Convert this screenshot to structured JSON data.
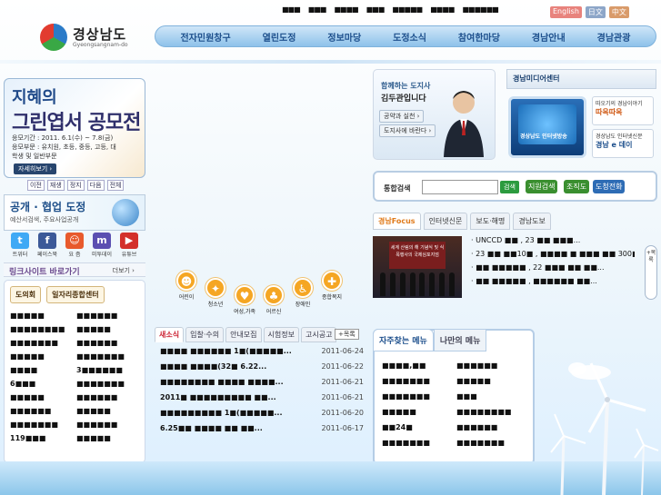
{
  "header": {
    "logo": {
      "title": "경상남도",
      "subtitle": "Gyeongsangnam-do"
    },
    "utility_links": [
      "■■■",
      "■■■",
      "■■■■",
      "■■■",
      "■■■■■",
      "■■■■",
      "■■■■■■"
    ],
    "languages": [
      {
        "label": "English",
        "color": "#e8837d"
      },
      {
        "label": "日文",
        "color": "#8da6c8"
      },
      {
        "label": "中文",
        "color": "#d99b6a"
      }
    ],
    "gnb": [
      "전자민원창구",
      "열린도정",
      "정보마당",
      "도정소식",
      "참여한마당",
      "경남안내",
      "경남관광"
    ]
  },
  "banner": {
    "line1": "지혜의",
    "line2": "그린엽서 공모전",
    "period": "응모기간 : 2011. 6.1(수) ~ 7.8(금)",
    "category": "응모부문 : 유치원, 초등, 중등, 고등, 대학생 및 일반부문",
    "more": "자세히보기 ›",
    "nav": [
      "이전",
      "재생",
      "정지",
      "다음",
      "전체"
    ]
  },
  "open_banner": {
    "title": "공개 · 협업 도정",
    "sub": "예산서검색, 주요사업공개"
  },
  "sns": [
    {
      "label": "트위터",
      "glyph": "t",
      "color": "#3fa9f5"
    },
    {
      "label": "페이스북",
      "glyph": "f",
      "color": "#3b5998"
    },
    {
      "label": "요 즘",
      "glyph": "☺",
      "color": "#e85a2c"
    },
    {
      "label": "미투데이",
      "glyph": "m",
      "color": "#5b4fb1"
    },
    {
      "label": "유튜브",
      "glyph": "▶",
      "color": "#d3302a"
    }
  ],
  "link_site": {
    "title": "링크사이트 바로가기",
    "more": "더보기 ›"
  },
  "left_list": {
    "tabs": [
      "도의회",
      "일자리종합센터"
    ],
    "items": [
      "■■■■■",
      "■■■■■■",
      "■■■■■■■■",
      "■■■■■",
      "■■■■■■■",
      "■■■■■■",
      "■■■■■",
      "■■■■■■■",
      "■■■■",
      "3■■■■■■",
      "6■■■",
      "■■■■■■■",
      "■■■■■",
      "■■■■■■",
      "■■■■■■",
      "■■■■■",
      "■■■■■■■",
      "■■■■■■",
      "119■■■",
      "■■■■■"
    ]
  },
  "icon_menu": [
    {
      "label": "어린이",
      "glyph": "☻"
    },
    {
      "label": "청소년",
      "glyph": "✦"
    },
    {
      "label": "여성,가족",
      "glyph": "♥"
    },
    {
      "label": "어르신",
      "glyph": "♣"
    },
    {
      "label": "장애인",
      "glyph": "♿"
    },
    {
      "label": "종합복지",
      "glyph": "✚"
    }
  ],
  "news": {
    "tabs": [
      "새소식",
      "입찰·수의",
      "안내모집",
      "시험정보",
      "고시공고"
    ],
    "more": "+목록",
    "rows": [
      {
        "title": "■■■■ ■■■■■■ 1■(■■■■■...",
        "date": "2011-06-24"
      },
      {
        "title": "■■■■ ■■■■(32■ 6.22...",
        "date": "2011-06-22"
      },
      {
        "title": "■■■■■■■■ ■■■■ ■■■■...",
        "date": "2011-06-21"
      },
      {
        "title": "2011■ ■■■■■■■■■ ■■...",
        "date": "2011-06-21"
      },
      {
        "title": "■■■■■■■■■ 1■(■■■■■...",
        "date": "2011-06-20"
      },
      {
        "title": "6.25■■ ■■■■ ■■ ■■...",
        "date": "2011-06-17"
      }
    ]
  },
  "governor": {
    "line1": "함께하는 도지사",
    "line2": "김두관입니다",
    "btn1": "공약과 실천 ›",
    "btn2": "도지사에 바란다 ›"
  },
  "media": {
    "title": "경남미디어센터",
    "tv_label": "경상남도 인터넷방송",
    "box1_line1": "따오기의 경남이야기",
    "box1_brand": "따옥따옥",
    "box2_line1": "경상남도 인터넷신문",
    "box2_brand": "경남 e 데이"
  },
  "search": {
    "label": "통합검색",
    "go": "검색",
    "buttons": [
      {
        "label": "지원검색",
        "color": "#3a8f2f"
      },
      {
        "label": "조직도",
        "color": "#3a8f2f"
      },
      {
        "label": "도청전화",
        "color": "#2e6cb5"
      }
    ]
  },
  "focus": {
    "tabs": [
      "경남Focus",
      "인터넷신문",
      "보도·해명",
      "경남도보"
    ],
    "screen_text": "세계 산림의 해 기념식 및 식목행사의 국제심포지엄",
    "items": [
      "· UNCCD ■■ , 23 ■■ ■■■...",
      "· 23 ■■ ■■10■ , ■■■■ ■ ■■■ ■■ 300■",
      "· ■■ ■■■■■ , 22 ■■■ ■■ ■■...",
      "· ■■ ■■■■■ , ■■■■■■ ■■..."
    ],
    "side": "+목록"
  },
  "freq_menu": {
    "tabs": [
      "자주찾는 메뉴",
      "나만의 메뉴"
    ],
    "items": [
      "■■■■,■■",
      "■■■■■■",
      "■■■■■■■",
      "■■■■■",
      "■■■■■■■",
      "■■■",
      "■■■■■",
      "■■■■■■■■",
      "■■24■",
      "■■■■■■",
      "■■■■■■■",
      "■■■■■■■"
    ]
  }
}
